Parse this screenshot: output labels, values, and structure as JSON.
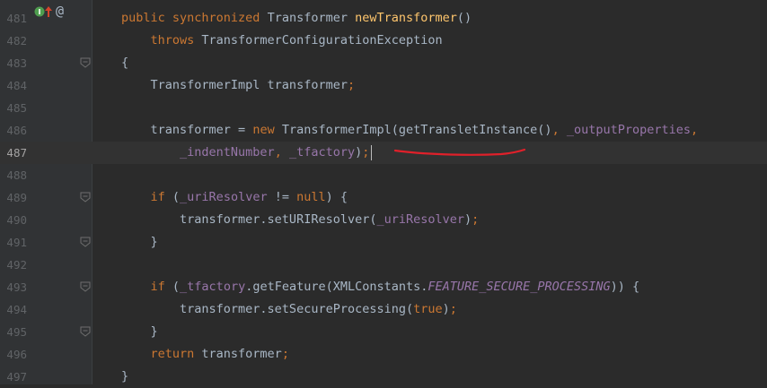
{
  "editor": {
    "lines": [
      {
        "num": "481",
        "tokens": [
          {
            "t": "public ",
            "c": "kw"
          },
          {
            "t": "synchronized ",
            "c": "kw"
          },
          {
            "t": "Transformer ",
            "c": "plain"
          },
          {
            "t": "newTransformer",
            "c": "fn"
          },
          {
            "t": "()",
            "c": "plain"
          }
        ]
      },
      {
        "num": "482",
        "tokens": [
          {
            "t": "    throws ",
            "c": "kw"
          },
          {
            "t": "TransformerConfigurationException",
            "c": "plain"
          }
        ]
      },
      {
        "num": "483",
        "tokens": [
          {
            "t": "{",
            "c": "plain"
          }
        ]
      },
      {
        "num": "484",
        "tokens": [
          {
            "t": "    TransformerImpl transformer",
            "c": "plain"
          },
          {
            "t": ";",
            "c": "kw"
          }
        ]
      },
      {
        "num": "485",
        "tokens": []
      },
      {
        "num": "486",
        "tokens": [
          {
            "t": "    transformer = ",
            "c": "plain"
          },
          {
            "t": "new ",
            "c": "kw"
          },
          {
            "t": "TransformerImpl(getTransletInstance()",
            "c": "plain"
          },
          {
            "t": ", ",
            "c": "kw"
          },
          {
            "t": "_outputProperties",
            "c": "fld"
          },
          {
            "t": ",",
            "c": "kw"
          }
        ]
      },
      {
        "num": "487",
        "tokens": [
          {
            "t": "        _indentNumber",
            "c": "fld"
          },
          {
            "t": ", ",
            "c": "kw"
          },
          {
            "t": "_tfactory",
            "c": "fld"
          },
          {
            "t": ")",
            "c": "plain"
          },
          {
            "t": ";",
            "c": "kw"
          }
        ]
      },
      {
        "num": "488",
        "tokens": []
      },
      {
        "num": "489",
        "tokens": [
          {
            "t": "    if ",
            "c": "kw"
          },
          {
            "t": "(",
            "c": "plain"
          },
          {
            "t": "_uriResolver",
            "c": "fld"
          },
          {
            "t": " != ",
            "c": "plain"
          },
          {
            "t": "null",
            "c": "kw"
          },
          {
            "t": ") {",
            "c": "plain"
          }
        ]
      },
      {
        "num": "490",
        "tokens": [
          {
            "t": "        transformer.setURIResolver(",
            "c": "plain"
          },
          {
            "t": "_uriResolver",
            "c": "fld"
          },
          {
            "t": ")",
            "c": "plain"
          },
          {
            "t": ";",
            "c": "kw"
          }
        ]
      },
      {
        "num": "491",
        "tokens": [
          {
            "t": "    }",
            "c": "plain"
          }
        ]
      },
      {
        "num": "492",
        "tokens": []
      },
      {
        "num": "493",
        "tokens": [
          {
            "t": "    if ",
            "c": "kw"
          },
          {
            "t": "(",
            "c": "plain"
          },
          {
            "t": "_tfactory",
            "c": "fld"
          },
          {
            "t": ".getFeature(XMLConstants.",
            "c": "plain"
          },
          {
            "t": "FEATURE_SECURE_PROCESSING",
            "c": "cst"
          },
          {
            "t": ")) {",
            "c": "plain"
          }
        ]
      },
      {
        "num": "494",
        "tokens": [
          {
            "t": "        transformer.setSecureProcessing(",
            "c": "plain"
          },
          {
            "t": "true",
            "c": "kw"
          },
          {
            "t": ")",
            "c": "plain"
          },
          {
            "t": ";",
            "c": "kw"
          }
        ]
      },
      {
        "num": "495",
        "tokens": [
          {
            "t": "    }",
            "c": "plain"
          }
        ]
      },
      {
        "num": "496",
        "tokens": [
          {
            "t": "    return ",
            "c": "kw"
          },
          {
            "t": "transformer",
            "c": "plain"
          },
          {
            "t": ";",
            "c": "kw"
          }
        ]
      },
      {
        "num": "497",
        "tokens": [
          {
            "t": "}",
            "c": "plain"
          }
        ]
      }
    ],
    "current_line": "487",
    "fold_lines": [
      "483",
      "489",
      "491",
      "493",
      "495"
    ],
    "gutter_icons": [
      "implements-marker-icon",
      "override-up-arrow-icon",
      "annotation-at-icon"
    ],
    "colors": {
      "background": "#2b2b2b",
      "gutter": "#313335",
      "keyword": "#cc7832",
      "method_decl": "#ffc66d",
      "field": "#9876aa",
      "text": "#a9b7c6",
      "annotation_stroke": "#e0202a"
    }
  }
}
